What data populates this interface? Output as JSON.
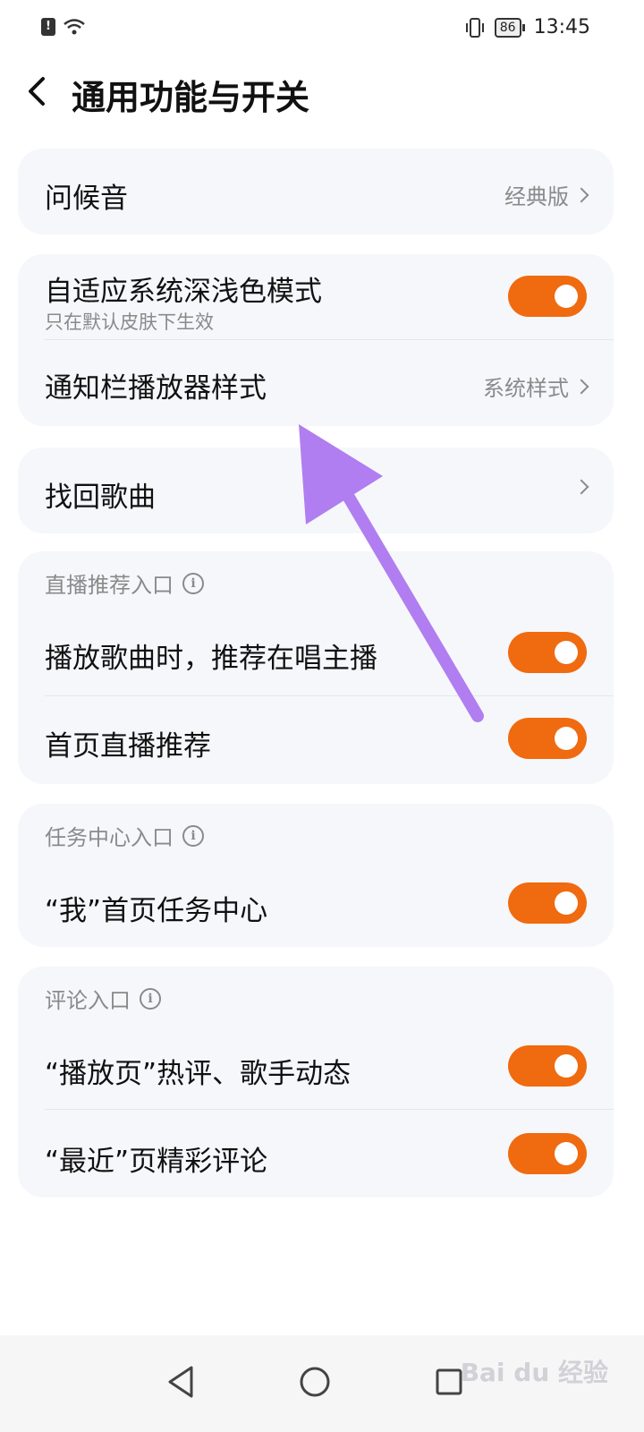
{
  "status_bar": {
    "time": "13:45",
    "battery": "86"
  },
  "header": {
    "title": "通用功能与开关"
  },
  "sections": {
    "greeting": {
      "label": "问候音",
      "value": "经典版"
    },
    "adaptive": {
      "label": "自适应系统深浅色模式",
      "sub": "只在默认皮肤下生效",
      "on": true
    },
    "notif_player": {
      "label": "通知栏播放器样式",
      "value": "系统样式"
    },
    "recover": {
      "label": "找回歌曲"
    },
    "live": {
      "header": "直播推荐入口",
      "items": [
        {
          "label": "播放歌曲时，推荐在唱主播",
          "on": true
        },
        {
          "label": "首页直播推荐",
          "on": true
        }
      ]
    },
    "task": {
      "header": "任务中心入口",
      "items": [
        {
          "label": "“我”首页任务中心",
          "on": true
        }
      ]
    },
    "comment": {
      "header": "评论入口",
      "items": [
        {
          "label": "“播放页”热评、歌手动态",
          "on": true
        },
        {
          "label": "“最近”页精彩评论",
          "on": true
        }
      ]
    }
  },
  "watermark": "Bai du 经验",
  "colors": {
    "accent": "#f06a0f",
    "card_bg": "#f6f7fb",
    "annotation": "#b07ef0"
  }
}
